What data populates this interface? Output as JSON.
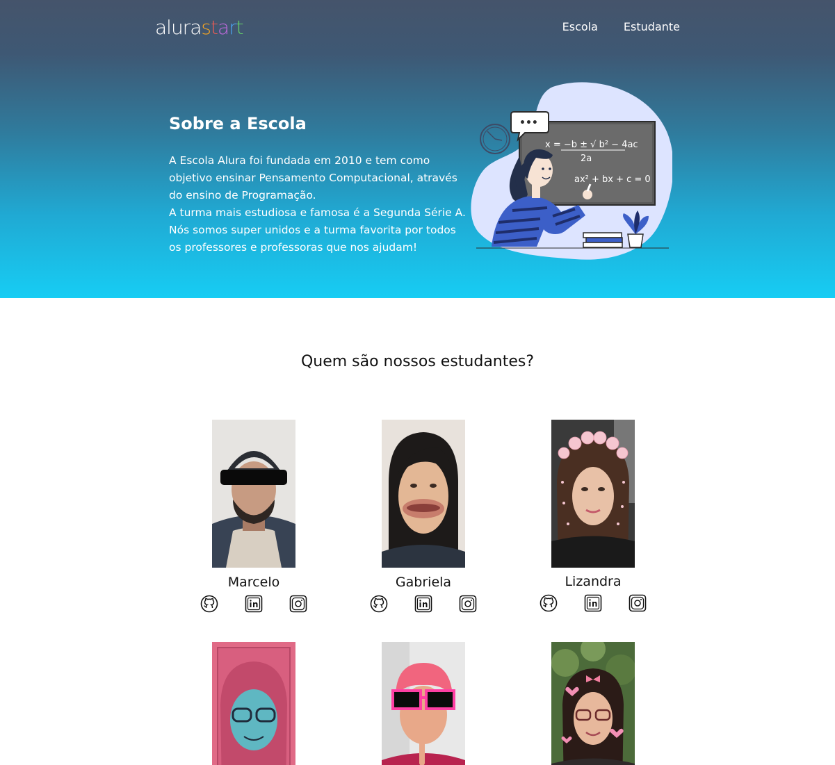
{
  "header": {
    "logo_part1": "alura",
    "logo_part2": [
      "s",
      "t",
      "a",
      "r",
      "t"
    ],
    "nav": [
      {
        "label": "Escola"
      },
      {
        "label": "Estudante"
      }
    ]
  },
  "about": {
    "title": "Sobre a Escola",
    "paragraphs": [
      "A Escola Alura foi fundada em 2010 e tem como objetivo ensinar Pensamento Computacional, através do ensino de Programação.",
      "A turma mais estudiosa e famosa é a Segunda Série A. Nós somos super unidos e a turma favorita por todos os professores e professoras que nos ajudam!"
    ],
    "board": {
      "formula_top": "x = −b ± √ b² − 4ac",
      "formula_bottom": "2a",
      "equation": "ax² + bx + c = 0",
      "bubble": "•••"
    }
  },
  "students": {
    "title": "Quem são nossos estudantes?",
    "items": [
      {
        "name": "Marcelo"
      },
      {
        "name": "Gabriela"
      },
      {
        "name": "Lizandra"
      },
      {
        "name": ""
      },
      {
        "name": ""
      },
      {
        "name": ""
      }
    ]
  },
  "colors": {
    "hero_top": "#45546b",
    "hero_bottom": "#17cdf4",
    "logo_accents": [
      "#f6a623",
      "#f25c54",
      "#c06ade",
      "#4aa3f0",
      "#67d36b"
    ]
  },
  "icons": {
    "social": [
      "github-icon",
      "linkedin-icon",
      "instagram-icon"
    ]
  }
}
